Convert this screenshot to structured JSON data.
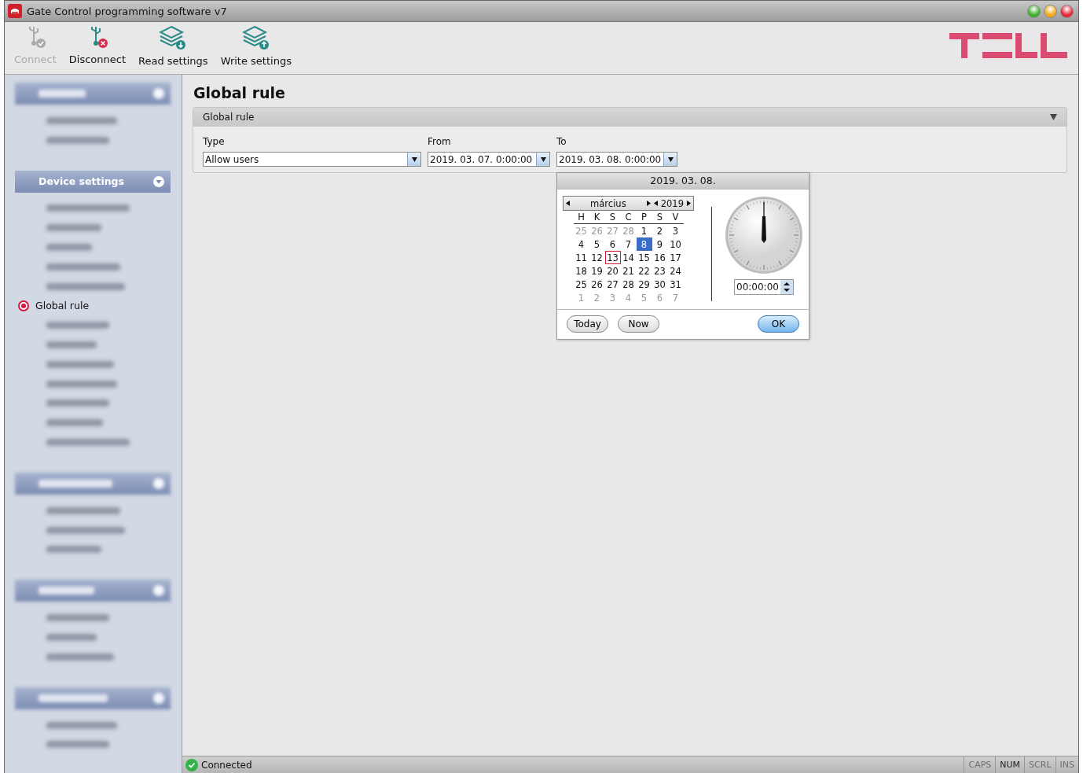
{
  "window": {
    "title": "Gate Control programming software v7"
  },
  "toolbar": [
    {
      "kind": "connect",
      "label": "Connect",
      "disabled": true
    },
    {
      "kind": "disconnect",
      "label": "Disconnect",
      "disabled": false
    },
    {
      "kind": "read",
      "label": "Read settings",
      "disabled": false
    },
    {
      "kind": "write",
      "label": "Write settings",
      "disabled": false
    }
  ],
  "sidebar": {
    "sections": [
      {
        "kind": "blurred",
        "items": [
          {
            "kind": "blurred"
          },
          {
            "kind": "blurred"
          }
        ]
      },
      {
        "kind": "header",
        "title": "Device settings",
        "expanded": true,
        "items": [
          {
            "kind": "blurred"
          },
          {
            "kind": "blurred"
          },
          {
            "kind": "blurred"
          },
          {
            "kind": "blurred"
          },
          {
            "kind": "blurred"
          },
          {
            "kind": "text",
            "label": "Global rule",
            "selected": true
          },
          {
            "kind": "blurred"
          },
          {
            "kind": "blurred"
          },
          {
            "kind": "blurred"
          },
          {
            "kind": "blurred"
          },
          {
            "kind": "blurred"
          },
          {
            "kind": "blurred"
          },
          {
            "kind": "blurred"
          }
        ]
      },
      {
        "kind": "blurred",
        "items": [
          {
            "kind": "blurred"
          },
          {
            "kind": "blurred"
          },
          {
            "kind": "blurred"
          }
        ]
      },
      {
        "kind": "blurred",
        "items": [
          {
            "kind": "blurred"
          },
          {
            "kind": "blurred"
          },
          {
            "kind": "blurred"
          }
        ]
      },
      {
        "kind": "blurred",
        "items": [
          {
            "kind": "blurred"
          },
          {
            "kind": "blurred"
          }
        ]
      }
    ]
  },
  "page": {
    "title": "Global rule",
    "panel": {
      "title": "Global rule",
      "expanded": true,
      "fields": [
        {
          "label": "Type",
          "value": "Allow users"
        },
        {
          "label": "From",
          "value": "2019. 03. 07. 0:00:00"
        },
        {
          "label": "To",
          "value": "2019. 03. 08. 0:00:00"
        }
      ]
    }
  },
  "date_picker": {
    "header": "2019. 03. 08.",
    "month": "március",
    "year": "2019",
    "weekdays": [
      "H",
      "K",
      "S",
      "C",
      "P",
      "S",
      "V"
    ],
    "weeks": [
      [
        {
          "d": "25",
          "other": true,
          "selected": false,
          "today": false
        },
        {
          "d": "26",
          "other": true,
          "selected": false,
          "today": false
        },
        {
          "d": "27",
          "other": true,
          "selected": false,
          "today": false
        },
        {
          "d": "28",
          "other": true,
          "selected": false,
          "today": false
        },
        {
          "d": "1",
          "other": false,
          "selected": false,
          "today": false
        },
        {
          "d": "2",
          "other": false,
          "selected": false,
          "today": false
        },
        {
          "d": "3",
          "other": false,
          "selected": false,
          "today": false
        }
      ],
      [
        {
          "d": "4",
          "other": false,
          "selected": false,
          "today": false
        },
        {
          "d": "5",
          "other": false,
          "selected": false,
          "today": false
        },
        {
          "d": "6",
          "other": false,
          "selected": false,
          "today": false
        },
        {
          "d": "7",
          "other": false,
          "selected": false,
          "today": false
        },
        {
          "d": "8",
          "other": false,
          "selected": true,
          "today": false
        },
        {
          "d": "9",
          "other": false,
          "selected": false,
          "today": false
        },
        {
          "d": "10",
          "other": false,
          "selected": false,
          "today": false
        }
      ],
      [
        {
          "d": "11",
          "other": false,
          "selected": false,
          "today": false
        },
        {
          "d": "12",
          "other": false,
          "selected": false,
          "today": false
        },
        {
          "d": "13",
          "other": false,
          "selected": false,
          "today": true
        },
        {
          "d": "14",
          "other": false,
          "selected": false,
          "today": false
        },
        {
          "d": "15",
          "other": false,
          "selected": false,
          "today": false
        },
        {
          "d": "16",
          "other": false,
          "selected": false,
          "today": false
        },
        {
          "d": "17",
          "other": false,
          "selected": false,
          "today": false
        }
      ],
      [
        {
          "d": "18",
          "other": false,
          "selected": false,
          "today": false
        },
        {
          "d": "19",
          "other": false,
          "selected": false,
          "today": false
        },
        {
          "d": "20",
          "other": false,
          "selected": false,
          "today": false
        },
        {
          "d": "21",
          "other": false,
          "selected": false,
          "today": false
        },
        {
          "d": "22",
          "other": false,
          "selected": false,
          "today": false
        },
        {
          "d": "23",
          "other": false,
          "selected": false,
          "today": false
        },
        {
          "d": "24",
          "other": false,
          "selected": false,
          "today": false
        }
      ],
      [
        {
          "d": "25",
          "other": false,
          "selected": false,
          "today": false
        },
        {
          "d": "26",
          "other": false,
          "selected": false,
          "today": false
        },
        {
          "d": "27",
          "other": false,
          "selected": false,
          "today": false
        },
        {
          "d": "28",
          "other": false,
          "selected": false,
          "today": false
        },
        {
          "d": "29",
          "other": false,
          "selected": false,
          "today": false
        },
        {
          "d": "30",
          "other": false,
          "selected": false,
          "today": false
        },
        {
          "d": "31",
          "other": false,
          "selected": false,
          "today": false
        }
      ],
      [
        {
          "d": "1",
          "other": true,
          "selected": false,
          "today": false
        },
        {
          "d": "2",
          "other": true,
          "selected": false,
          "today": false
        },
        {
          "d": "3",
          "other": true,
          "selected": false,
          "today": false
        },
        {
          "d": "4",
          "other": true,
          "selected": false,
          "today": false
        },
        {
          "d": "5",
          "other": true,
          "selected": false,
          "today": false
        },
        {
          "d": "6",
          "other": true,
          "selected": false,
          "today": false
        },
        {
          "d": "7",
          "other": true,
          "selected": false,
          "today": false
        }
      ]
    ],
    "time": "00:00:00",
    "buttons": [
      {
        "kind": "plain",
        "label": "Today"
      },
      {
        "kind": "plain",
        "label": "Now"
      },
      {
        "kind": "primary",
        "label": "OK"
      }
    ]
  },
  "status_bar": {
    "status": "Connected",
    "indicators": [
      {
        "label": "CAPS",
        "on": false
      },
      {
        "label": "NUM",
        "on": true
      },
      {
        "label": "SCRL",
        "on": false
      },
      {
        "label": "INS",
        "on": false
      }
    ]
  }
}
